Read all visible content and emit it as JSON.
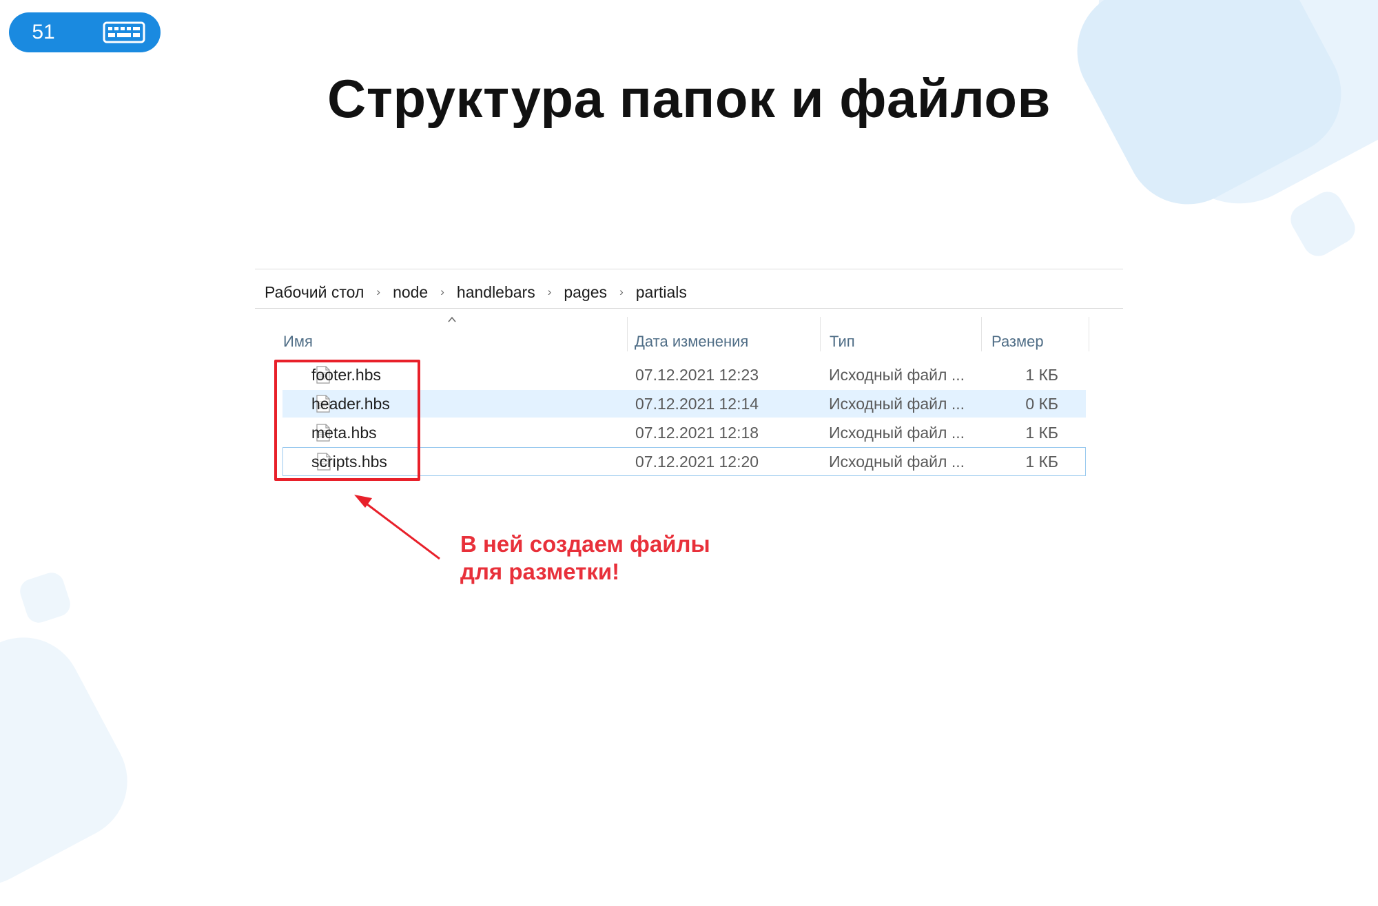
{
  "slide": {
    "number": "51",
    "title": "Структура папок и файлов",
    "callout_line1": "В ней создаем файлы",
    "callout_line2": "для разметки!"
  },
  "colors": {
    "accent": "#1a8ae0",
    "highlight": "#e8202a",
    "callout": "#e8303a"
  },
  "explorer": {
    "breadcrumb": [
      "Рабочий стол",
      "node",
      "handlebars",
      "pages",
      "partials"
    ],
    "columns": {
      "name": "Имя",
      "date": "Дата изменения",
      "type": "Тип",
      "size": "Размер"
    },
    "files": [
      {
        "name": "footer.hbs",
        "date": "07.12.2021 12:23",
        "type": "Исходный файл ...",
        "size": "1 КБ",
        "state": "normal"
      },
      {
        "name": "header.hbs",
        "date": "07.12.2021 12:14",
        "type": "Исходный файл ...",
        "size": "0 КБ",
        "state": "selected"
      },
      {
        "name": "meta.hbs",
        "date": "07.12.2021 12:18",
        "type": "Исходный файл ...",
        "size": "1 КБ",
        "state": "normal"
      },
      {
        "name": "scripts.hbs",
        "date": "07.12.2021 12:20",
        "type": "Исходный файл ...",
        "size": "1 КБ",
        "state": "focused"
      }
    ]
  },
  "icons": {
    "slide_badge": "keyboard-icon",
    "file": "file-icon",
    "sort": "chevron-up-icon",
    "breadcrumb_separator": "chevron-right-icon"
  }
}
